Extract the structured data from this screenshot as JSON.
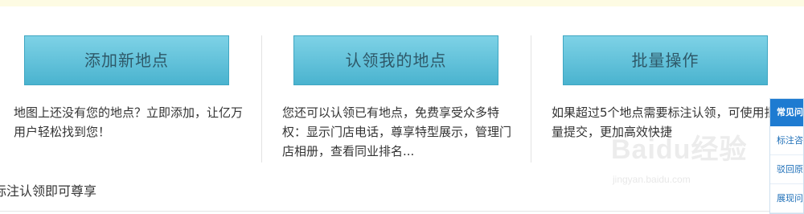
{
  "cards": [
    {
      "button_label": "添加新地点",
      "description": "地图上还没有您的地点？立即添加，让亿万用户轻松找到您！"
    },
    {
      "button_label": "认领我的地点",
      "description": "您还可以认领已有地点，免费享受众多特权：显示门店电话，尊享特型展示，管理门店相册，查看同业排名..."
    },
    {
      "button_label": "批量操作",
      "description": "如果超过5个地点需要标注认领，可使用批量提交，更加高效快捷"
    }
  ],
  "bottom_text": "标注认领即可尊享",
  "faq": {
    "title": "常见问",
    "items": [
      "标注咨",
      "驳回原",
      "展现问"
    ]
  },
  "watermark": {
    "main": "Baidu经验",
    "sub": "jingyan.baidu.com"
  }
}
